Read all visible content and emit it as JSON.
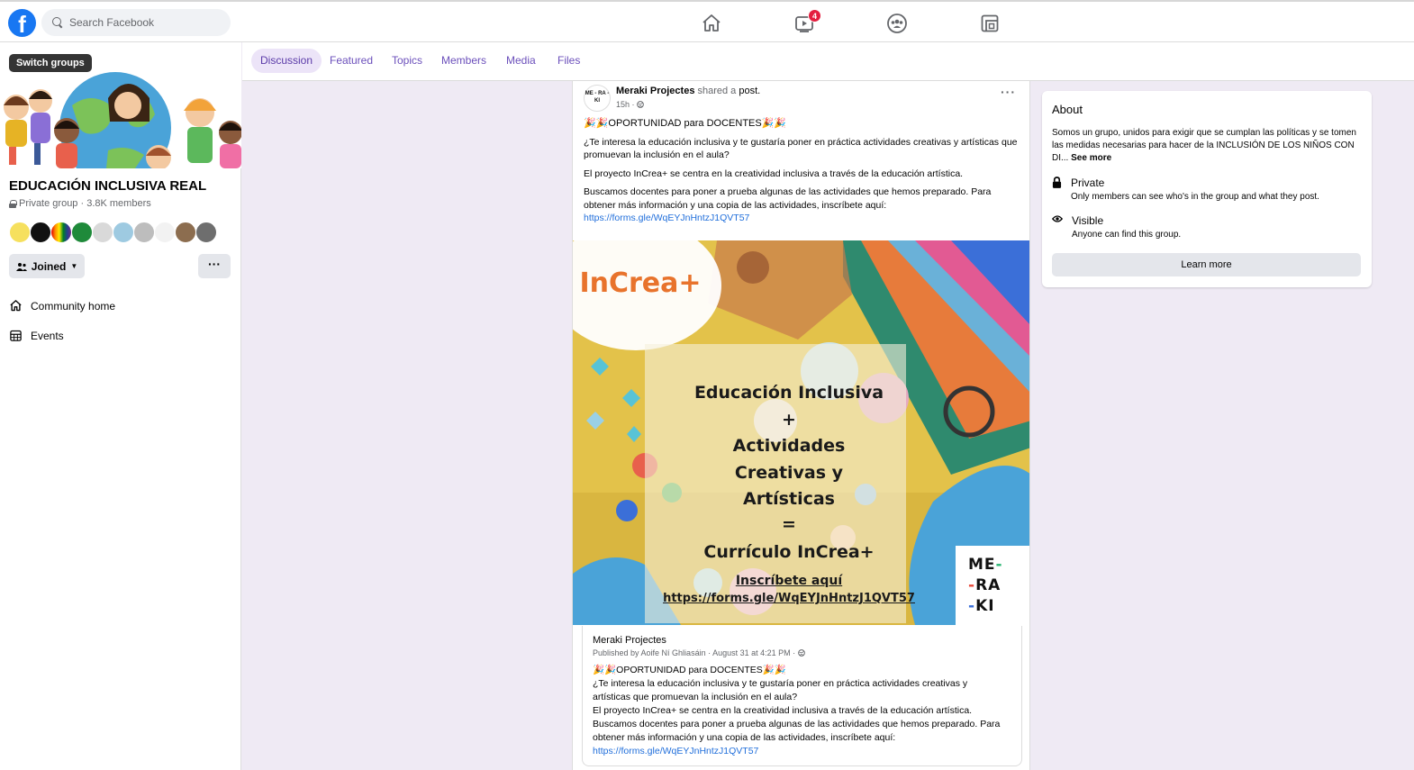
{
  "topbar": {
    "logo": "f",
    "search_placeholder": "Search Facebook",
    "watch_badge": "4",
    "icons": [
      "home-icon",
      "watch-icon",
      "groups-icon",
      "gaming-icon"
    ]
  },
  "sidebar": {
    "switch_groups": "Switch groups",
    "group_name": "EDUCACIÓN INCLUSIVA REAL",
    "group_meta": "Private group · 3.8K members",
    "joined_label": "Joined",
    "more_label": "···",
    "nav": [
      {
        "label": "Community home",
        "icon": "home-outline-icon"
      },
      {
        "label": "Events",
        "icon": "calendar-icon"
      }
    ]
  },
  "tabs": [
    {
      "label": "Discussion",
      "active": true
    },
    {
      "label": "Featured",
      "active": false
    },
    {
      "label": "Topics",
      "active": false
    },
    {
      "label": "Members",
      "active": false
    },
    {
      "label": "Media",
      "active": false
    },
    {
      "label": "Files",
      "active": false
    }
  ],
  "post": {
    "avatar_text": "ME - RA - KI",
    "author": "Meraki Projectes",
    "action_mid": " shared a ",
    "action_end": "post.",
    "time": "15h · ",
    "headline": "🎉🎉OPORTUNIDAD para DOCENTES🎉🎉",
    "para1": "¿Te interesa la educación inclusiva y te gustaría poner en práctica actividades creativas y artísticas que promuevan la inclusión en el aula?",
    "para2": "El proyecto InCrea+ se centra en la creatividad inclusiva a través de la educación artística.",
    "para3": "Buscamos docentes para poner a prueba algunas de las actividades que hemos preparado. Para obtener más información y una copia de las actividades, inscríbete aquí:",
    "link": "https://forms.gle/WqEYJnHntzJ1QVT57",
    "image": {
      "logo": "InCrea+",
      "line1": "Educación Inclusiva",
      "plus": "+",
      "line2": "Actividades",
      "line3": "Creativas y",
      "line4": "Artísticas",
      "equals": "=",
      "line5": "Currículo InCrea+",
      "cta": "Inscríbete aquí",
      "url": "https://forms.gle/WqEYJnHntzJ1QVT57",
      "corner_logo": [
        "ME",
        "RA",
        "KI"
      ]
    },
    "shared": {
      "name": "Meraki Projectes",
      "meta": "Published by Aoife Ní Ghliasáin · August 31 at 4:21 PM · ",
      "headline": "🎉🎉OPORTUNIDAD para DOCENTES🎉🎉",
      "para1": "¿Te interesa la educación inclusiva y te gustaría poner en práctica actividades creativas y artísticas que promuevan la inclusión en el aula?",
      "para2": "El proyecto InCrea+ se centra en la creatividad inclusiva a través de la educación artística.",
      "para3": "Buscamos docentes para poner a prueba algunas de las actividades que hemos preparado. Para obtener más información y una copia de las actividades, inscríbete aquí:",
      "link": "https://forms.gle/WqEYJnHntzJ1QVT57"
    }
  },
  "about": {
    "title": "About",
    "description": "Somos un grupo, unidos para exigir que se cumplan las políticas y se tomen las medidas necesarias para hacer de la INCLUSIÓN DE LOS NIÑOS CON DI...",
    "see_more": "See more",
    "private_title": "Private",
    "private_desc": "Only members can see who's in the group and what they post.",
    "visible_title": "Visible",
    "visible_desc": "Anyone can find this group.",
    "learn_more": "Learn more"
  },
  "colors": {
    "facebook_blue": "#1877f2",
    "tab_purple": "#6b4fbb",
    "badge_red": "#e41e3f",
    "link_blue": "#216fdb"
  }
}
